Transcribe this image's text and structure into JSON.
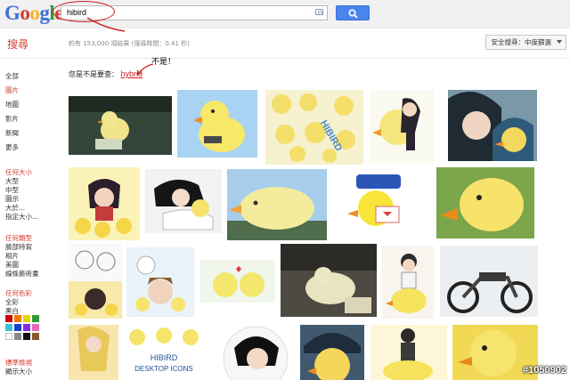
{
  "header": {
    "logo_parts": [
      "G",
      "o",
      "o",
      "g",
      "l",
      "e"
    ],
    "query": "hibird"
  },
  "toolbar": {
    "heading": "搜尋",
    "stats": "約有 153,000 項結果 (搜尋時間：0.41 秒)",
    "safesearch": "安全搜尋：中度篩選"
  },
  "sidebar": {
    "nav": [
      "全部",
      "圖片",
      "地圖",
      "影片",
      "新聞",
      "更多"
    ],
    "active_index": 1,
    "size_heading": "任何大小",
    "size_items": [
      "大型",
      "中型",
      "圖示",
      "大於...",
      "指定大小..."
    ],
    "type_heading": "任何類型",
    "type_items": [
      "臉部特寫",
      "相片",
      "美圖",
      "線條藝術畫"
    ],
    "color_heading": "任何色彩",
    "color_items": [
      "全彩",
      "黑白"
    ],
    "swatch_colors": [
      "#cc0000",
      "#f07800",
      "#e6d500",
      "#2e9c32",
      "#3fbfd9",
      "#1b3fd0",
      "#8a2be2",
      "#e66bb5",
      "#ffffff",
      "#888888",
      "#111111",
      "#8b5a2b"
    ],
    "view_heading": "標準檢視",
    "view_items": [
      "顯示大小"
    ]
  },
  "results": {
    "did_you_mean_label": "您是不是要查：",
    "did_you_mean_link": "hybrid",
    "annotation_note": "不是！"
  },
  "thumbs": {
    "desktop_icons_line1": "HIBIRD",
    "desktop_icons_line2": "DESKTOP ICONS",
    "hibird_logo": "HIBIRD",
    "watermark": "#1050902"
  }
}
